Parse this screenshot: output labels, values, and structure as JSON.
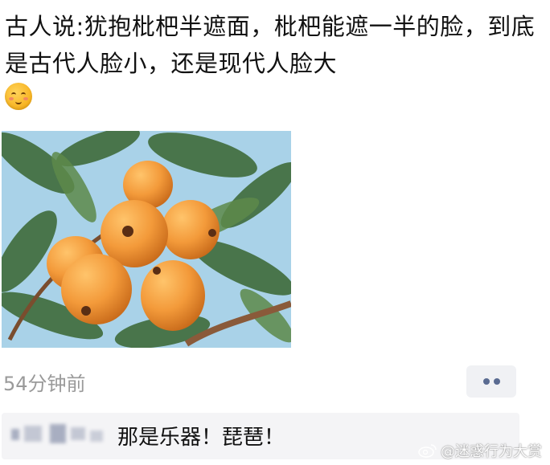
{
  "post": {
    "text": "古人说:犹抱枇杷半遮面，枇杷能遮一半的脸，到底是古代人脸小，还是现代人脸大",
    "emoji": "smiling-face-emoji",
    "image": "loquat-fruit-photo"
  },
  "meta": {
    "time": "54分钟前",
    "more_icon": "more-dots-icon"
  },
  "comment": {
    "author": "",
    "text": "那是乐器！琵琶！"
  },
  "watermark": {
    "logo": "weibo-logo-icon",
    "text": "@迷惑行为大赏"
  },
  "colors": {
    "text": "#111111",
    "meta": "#9a9a9a",
    "button_bg": "#f0f1f4",
    "dots": "#5a6b91",
    "comment_bg": "#f4f4f6",
    "fruit": "#f39a3a"
  }
}
